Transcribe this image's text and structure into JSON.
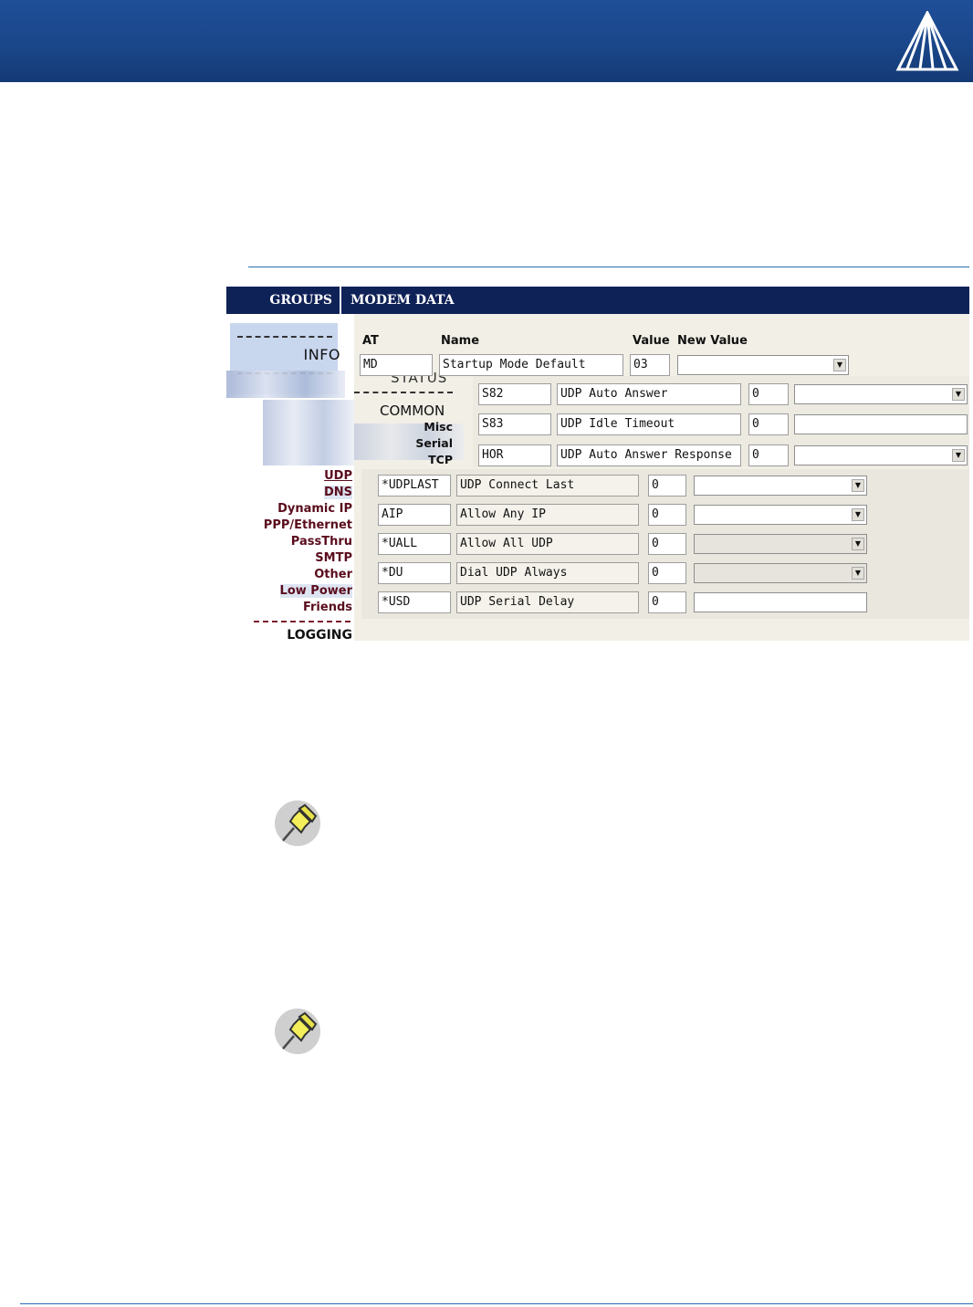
{
  "banner": {
    "logo": "airlink-triangle-logo",
    "color": "#1a468a"
  },
  "screenshot": {
    "groups_title": "GROUPS",
    "modem_title": "MODEM DATA",
    "left_nav": {
      "info": "INFO",
      "status": "STATUS",
      "common": "COMMON",
      "common_items": [
        "Misc",
        "Serial",
        "TCP"
      ],
      "links": [
        "UDP",
        "DNS",
        "Dynamic IP",
        "PPP/Ethernet",
        "PassThru",
        "SMTP",
        "Other",
        "Low Power",
        "Friends"
      ],
      "logging": "LOGGING"
    },
    "columns": {
      "at": "AT",
      "name": "Name",
      "value": "Value",
      "new_value": "New Value"
    },
    "top_row": {
      "at": "MD",
      "name": "Startup Mode Default",
      "value": "03"
    },
    "mid_rows": [
      {
        "at": "S82",
        "name": "UDP Auto Answer",
        "value": "0",
        "control": "select"
      },
      {
        "at": "S83",
        "name": "UDP Idle Timeout",
        "value": "0",
        "control": "text"
      },
      {
        "at": "HOR",
        "name": "UDP Auto Answer Response",
        "value": "0",
        "control": "select"
      }
    ],
    "rows": [
      {
        "at": "*UDPLAST",
        "name": "UDP Connect Last",
        "value": "0",
        "control": "select"
      },
      {
        "at": "AIP",
        "name": "Allow Any IP",
        "value": "0",
        "control": "select"
      },
      {
        "at": "*UALL",
        "name": "Allow All UDP",
        "value": "0",
        "control": "select-disabled"
      },
      {
        "at": "*DU",
        "name": "Dial UDP Always",
        "value": "0",
        "control": "select-disabled"
      },
      {
        "at": "*USD",
        "name": "UDP Serial Delay",
        "value": "0",
        "control": "text"
      }
    ]
  },
  "notes": [
    {
      "icon": "pushpin-icon"
    },
    {
      "icon": "pushpin-icon"
    }
  ],
  "colors": {
    "banner": "#1a468a",
    "panel_header": "#0f2257",
    "nav_link": "#5a0c1c",
    "rule": "#2a6fb0"
  }
}
